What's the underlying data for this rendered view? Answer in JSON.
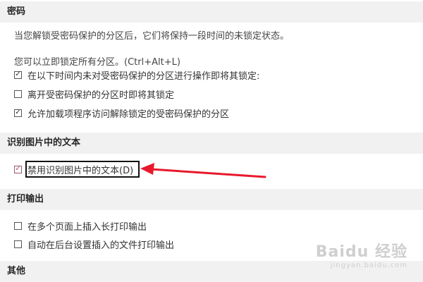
{
  "sections": {
    "password": {
      "title": "密码",
      "desc": "当您解锁受密码保护的分区后，它们将保持一段时间的未锁定状态。",
      "lock_all": "您可以立即锁定所有分区。(Ctrl+Alt+L)",
      "options": [
        {
          "label": "在以下时间内未对受密码保护的分区进行操作即将其锁定:",
          "checked": true
        },
        {
          "label": "离开受密码保护的分区时即将其锁定",
          "checked": false
        },
        {
          "label": "允许加载项程序访问解除锁定的受密码保护的分区",
          "checked": true
        }
      ]
    },
    "ocr": {
      "title": "识别图片中的文本",
      "options": [
        {
          "label": "禁用识别图片中的文本(D)",
          "checked": true
        }
      ]
    },
    "print": {
      "title": "打印输出",
      "options": [
        {
          "label": "在多个页面上插入长打印输出",
          "checked": false
        },
        {
          "label": "自动在后台设置插入的文件打印输出",
          "checked": false
        }
      ]
    },
    "other": {
      "title": "其他"
    }
  },
  "annotation": {
    "arrow_color": "#e8192c",
    "box_color": "#111111"
  },
  "watermark": {
    "brand": "Baidu 经验",
    "url": "jingyan.baidu.com"
  },
  "glyphs": {
    "check": "✓"
  }
}
